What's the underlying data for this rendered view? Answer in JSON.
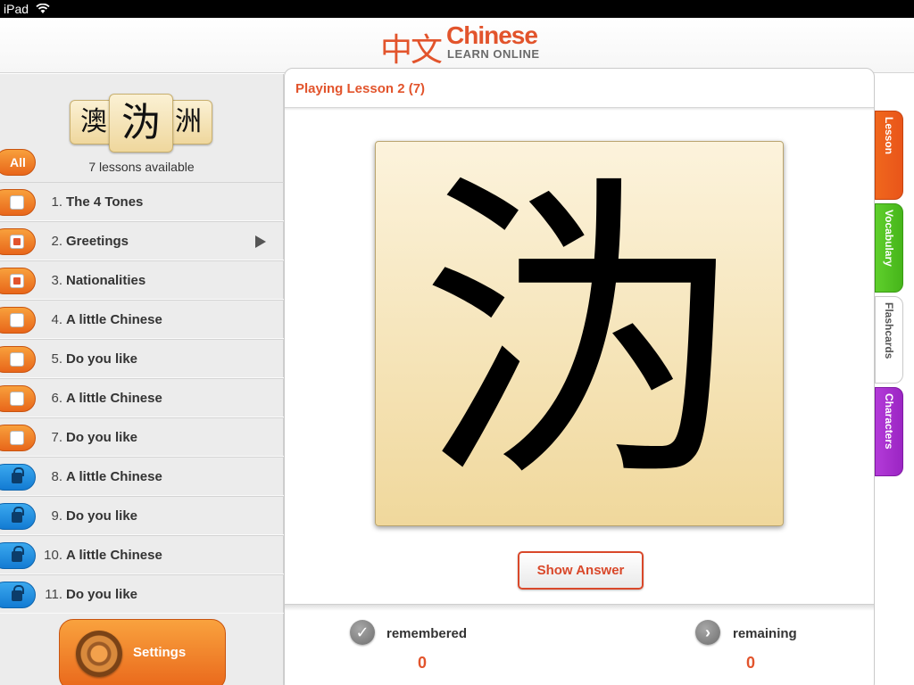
{
  "status_bar": {
    "device": "iPad"
  },
  "header": {
    "logo_cn": "中文",
    "logo_en": "Chinese",
    "logo_sub": "LEARN ONLINE"
  },
  "sidebar": {
    "chars": [
      "澳",
      "沩",
      "洲"
    ],
    "all_label": "All",
    "lessons_available": "7 lessons available",
    "lessons": [
      {
        "num": "1.",
        "title": "The 4 Tones",
        "state": "unchecked"
      },
      {
        "num": "2.",
        "title": "Greetings",
        "state": "checked",
        "selected": true
      },
      {
        "num": "3.",
        "title": "Nationalities",
        "state": "checked"
      },
      {
        "num": "4.",
        "title": "A little Chinese",
        "state": "unchecked"
      },
      {
        "num": "5.",
        "title": "Do you like",
        "state": "unchecked"
      },
      {
        "num": "6.",
        "title": "A little Chinese",
        "state": "unchecked"
      },
      {
        "num": "7.",
        "title": "Do you like",
        "state": "unchecked"
      },
      {
        "num": "8.",
        "title": "A little Chinese",
        "state": "locked"
      },
      {
        "num": "9.",
        "title": "Do you like",
        "state": "locked"
      },
      {
        "num": "10.",
        "title": "A little Chinese",
        "state": "locked"
      },
      {
        "num": "11.",
        "title": "Do you like",
        "state": "locked"
      }
    ],
    "settings_label": "Settings"
  },
  "main": {
    "title": "Playing Lesson 2 (7)",
    "card_char": "沩",
    "show_answer_label": "Show Answer",
    "remembered_label": "remembered",
    "remembered_value": "0",
    "remaining_label": "remaining",
    "remaining_value": "0"
  },
  "tabs": [
    {
      "label": "Lesson",
      "color": "#e9551a"
    },
    {
      "label": "Vocabulary",
      "color": "#46b51a"
    },
    {
      "label": "Flashcards",
      "color": "#ffffff",
      "active": true
    },
    {
      "label": "Characters",
      "color": "#9b25c3"
    }
  ],
  "colors": {
    "accent": "#e2542c",
    "locked": "#137bd3"
  }
}
